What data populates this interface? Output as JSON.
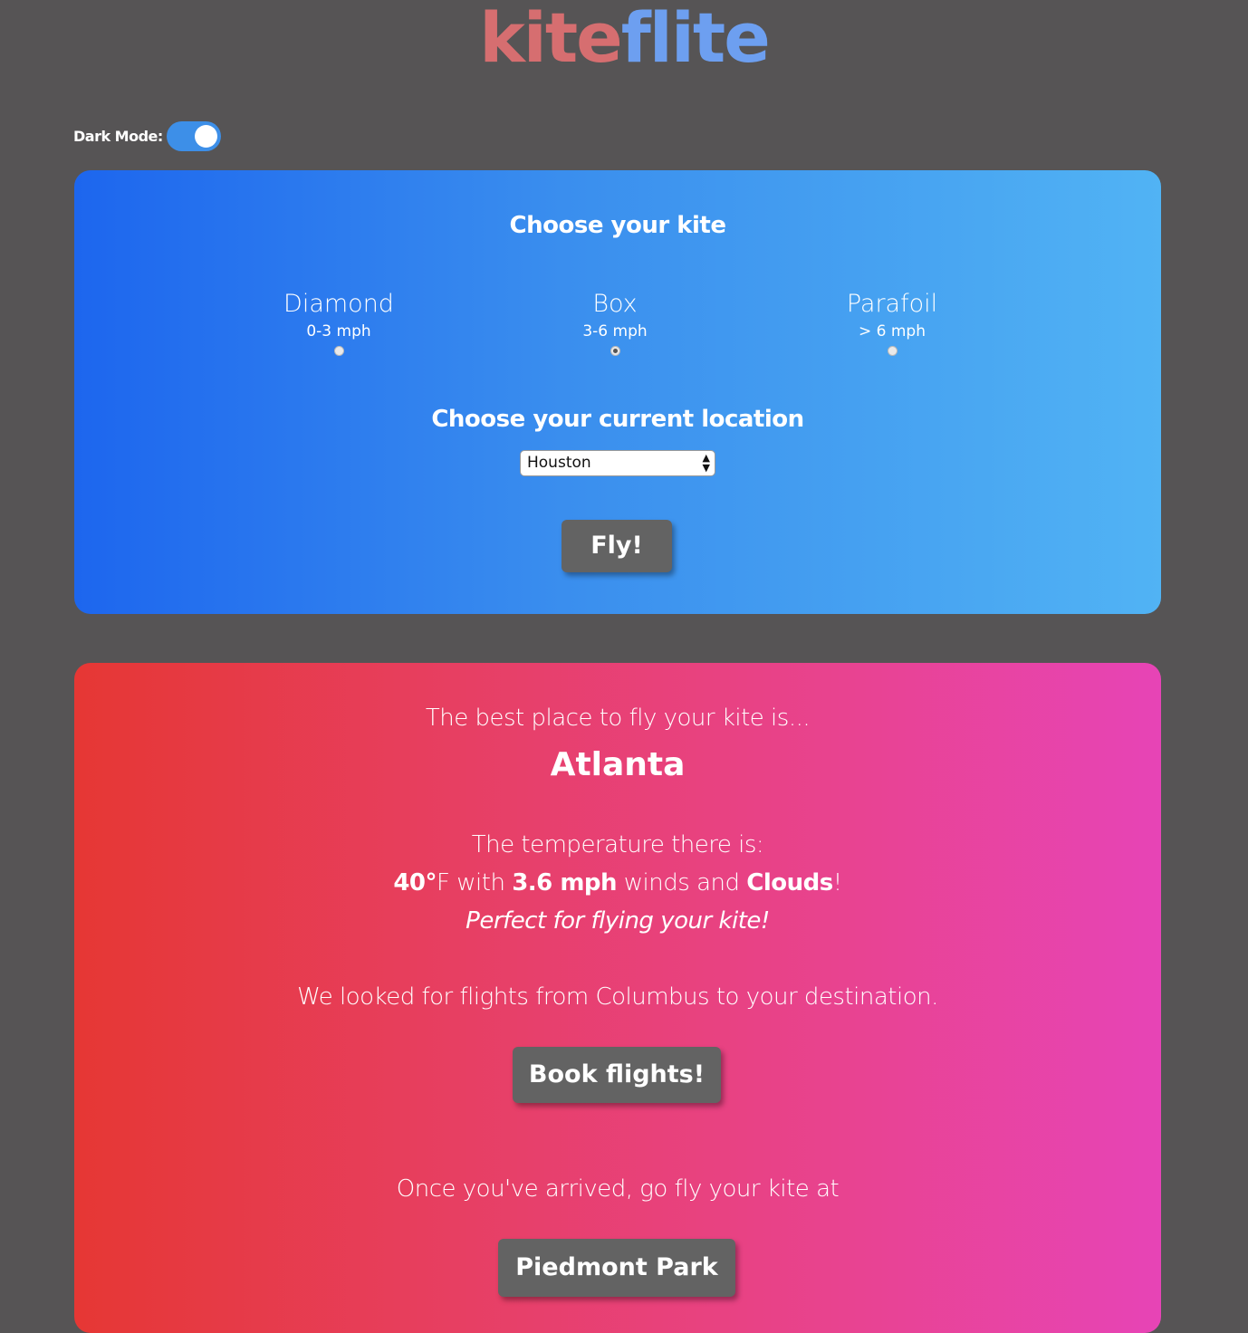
{
  "logo": {
    "part1": "kite",
    "part2": "flite",
    "color1": "#d66e70",
    "color2": "#6d9ff0"
  },
  "dark_mode": {
    "label": "Dark Mode:",
    "enabled": true
  },
  "kite_section": {
    "title": "Choose your kite",
    "options": [
      {
        "name": "Diamond",
        "speed": "0-3 mph",
        "selected": false
      },
      {
        "name": "Box",
        "speed": "3-6 mph",
        "selected": true
      },
      {
        "name": "Parafoil",
        "speed": "> 6 mph",
        "selected": false
      }
    ]
  },
  "location_section": {
    "title": "Choose your current location",
    "selected": "Houston"
  },
  "fly_button": "Fly!",
  "result": {
    "intro": "The best place to fly your kite is...",
    "destination": "Atlanta",
    "temp_intro": "The temperature there is:",
    "temp": "40°",
    "temp_unit": "F",
    "with_text": " with ",
    "wind": "3.6 mph",
    "winds_and": " winds and ",
    "condition": "Clouds",
    "exclaim": "!",
    "verdict": "Perfect for flying your kite!",
    "flights_text": "We looked for flights from Columbus to your destination.",
    "book_button": "Book flights!",
    "arrived_text": "Once you've arrived, go fly your kite at",
    "park_button": "Piedmont Park"
  },
  "colors": {
    "background": "#565455",
    "button": "#636363",
    "toggle": "#3d8fe8"
  }
}
